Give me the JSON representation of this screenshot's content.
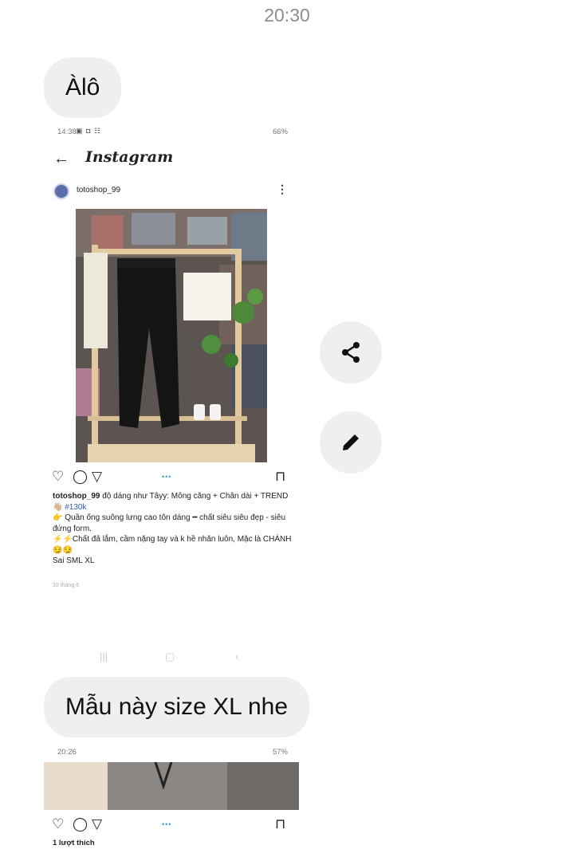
{
  "conversation": {
    "timestamp": "20:30",
    "messages": [
      {
        "text": "Àlô"
      },
      {
        "text": "Mẫu này size XL nhe"
      }
    ]
  },
  "attachment_1": {
    "status_time": "14:38",
    "status_right": "66%",
    "app_name": "Instagram",
    "username": "totoshop_99",
    "caption": {
      "username": "totoshop_99",
      "line1": "độ dáng như Tâyy: Mông căng + Chân dài + TREND 👋🏼",
      "hashtag": "#130k",
      "line2": "👉 Quần ống suông lưng cao tôn dáng ━ chất siêu siêu đẹp - siêu đứng form.",
      "line3": "⚡⚡Chất đã lắm, cầm nặng tay và k hề nhăn luôn, Mặc là CHÁNH 😏😏",
      "line4": "Sai SML XL"
    },
    "post_date": "10 tháng 6"
  },
  "attachment_2": {
    "status_time": "20:26",
    "status_right": "57%",
    "likes": "1 lượt thích"
  },
  "actions": {
    "share_icon": "share-icon",
    "edit_icon": "pencil-icon"
  }
}
